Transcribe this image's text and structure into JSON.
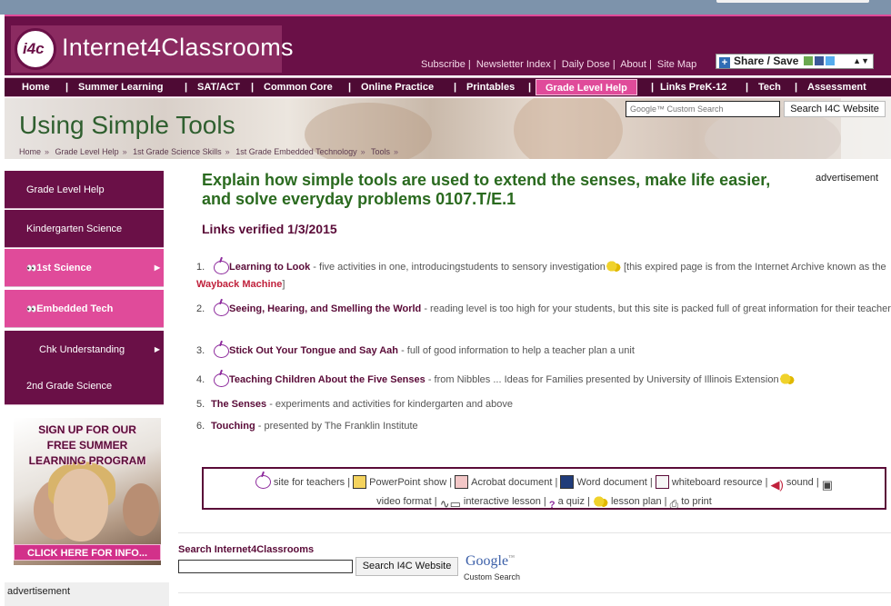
{
  "header": {
    "logo_badge": "i4c",
    "site_name": "Internet4Classrooms",
    "top_links": [
      "Subscribe",
      "Newsletter Index",
      "Daily Dose",
      "About",
      "Site Map"
    ],
    "share_label": "Share / Save"
  },
  "nav": {
    "items": [
      "Home",
      "Summer Learning",
      "SAT/ACT",
      "Common Core",
      "Online Practice",
      "Printables",
      "Grade Level Help",
      "Links PreK-12",
      "Tech",
      "Assessment"
    ],
    "active": "Grade Level Help"
  },
  "banner": {
    "title": "Using Simple Tools",
    "breadcrumbs": [
      "Home",
      "Grade Level Help",
      "1st Grade Science Skills",
      "1st Grade Embedded Technology",
      "Tools"
    ],
    "search_placeholder": "Google™ Custom Search",
    "search_button": "Search I4C Website"
  },
  "sidebar": {
    "items": [
      {
        "label": "Grade Level Help",
        "style": "dark",
        "prefix": "",
        "arrow": ""
      },
      {
        "label": "Kindergarten Science",
        "style": "dark",
        "prefix": "",
        "arrow": ""
      },
      {
        "label": "1st Science",
        "style": "pink",
        "prefix": "👀",
        "arrow": "▶"
      },
      {
        "label": "Embedded Tech",
        "style": "pink",
        "prefix": "👀",
        "arrow": ""
      },
      {
        "label": "Chk Understanding",
        "style": "dark",
        "prefix": "",
        "arrow": "▶"
      },
      {
        "label": "2nd Grade Science",
        "style": "dark",
        "prefix": "",
        "arrow": ""
      }
    ],
    "promo_heading": [
      "SIGN UP FOR OUR",
      "FREE SUMMER",
      "LEARNING PROGRAM"
    ],
    "promo_cta": "CLICK HERE FOR INFO...",
    "ad_label": "advertisement"
  },
  "main": {
    "title": "Explain how simple tools are used to extend the senses, make life easier, and solve everyday problems 0107.T/E.1",
    "ad_label": "advertisement",
    "verified": "Links verified 1/3/2015",
    "links": [
      {
        "num": "1.",
        "title": "Learning to Look",
        "desc": " - five activities in one, introducingstudents to sensory investigation",
        "extra": " [this expired page is from the Internet Archive known as the ",
        "archive": "Wayback Machine",
        "tail": "]"
      },
      {
        "num": "2.",
        "title": "Seeing, Hearing, and Smelling the World",
        "desc": "  - reading level is too high for your students, but this site is packed full of great information for their teacher"
      },
      {
        "num": "3.",
        "title": "Stick Out Your Tongue and Say Aah",
        "desc": "  - full of good information to help a teacher plan a unit"
      },
      {
        "num": "4.",
        "title": "Teaching Children About the Five Senses",
        "desc": "  - from Nibbles ... Ideas for Families presented by University of Illinois Extension"
      },
      {
        "num": "5.",
        "title": "The Senses",
        "desc": "  - experiments and activities for kindergarten and above"
      },
      {
        "num": "6.",
        "title": "Touching",
        "desc": "  - presented by The Franklin Institute"
      }
    ],
    "legend": [
      "site for teachers",
      "PowerPoint show",
      "Acrobat document",
      "Word document",
      "whiteboard resource",
      "sound",
      "video format",
      "interactive lesson",
      "a quiz",
      "lesson plan",
      "to print"
    ]
  },
  "footer_search": {
    "label": "Search Internet4Classrooms",
    "button": "Search I4C Website",
    "google": "Google",
    "google_sup": "™",
    "google_sub": "Custom Search"
  }
}
